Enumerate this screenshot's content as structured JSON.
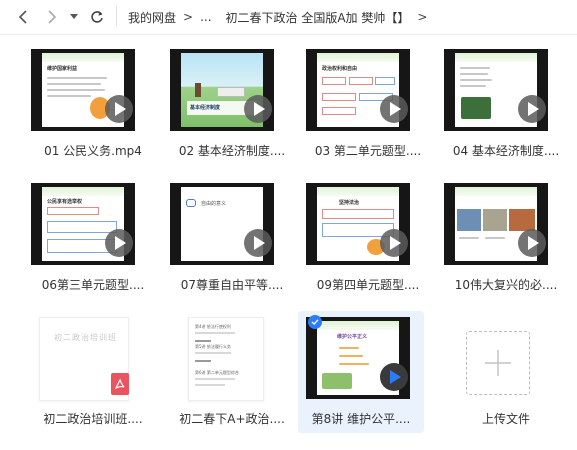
{
  "nav": {
    "back_glyph": "<",
    "forward_glyph": ">",
    "dropdown_glyph": "▾",
    "refresh_glyph": "↻"
  },
  "breadcrumb": {
    "root": "我的网盘",
    "sep": ">",
    "ellipsis": "...",
    "current": "初二春下政治 全国版A加 樊帅【】",
    "trailing": ">"
  },
  "files": [
    {
      "label": "01 公民义务.mp4",
      "kind": "video",
      "slide_title": "维护国家利益"
    },
    {
      "label": "02 基本经济制度....",
      "kind": "video",
      "slide_title": "基本经济制度"
    },
    {
      "label": "03 第二单元题型....",
      "kind": "video",
      "slide_title": "政治权利和自由"
    },
    {
      "label": "04 基本经济制度....",
      "kind": "video",
      "slide_title": ""
    },
    {
      "label": "06第三单元题型....",
      "kind": "video",
      "slide_title": "公民享有选举权"
    },
    {
      "label": "07尊重自由平等....",
      "kind": "video",
      "slide_title": "自由的意义"
    },
    {
      "label": "09第四单元题型....",
      "kind": "video",
      "slide_title": "坚持法治"
    },
    {
      "label": "10伟大复兴的必....",
      "kind": "video",
      "slide_title": ""
    },
    {
      "label": "初二政治培训班....",
      "kind": "pdf",
      "slide_title": "初二政治培训班"
    },
    {
      "label": "初二春下A+政治....",
      "kind": "doc",
      "slide_title": ""
    },
    {
      "label": "第8讲 维护公平....",
      "kind": "video",
      "slide_title": "维护公平正义",
      "selected": true
    },
    {
      "label": "上传文件",
      "kind": "upload",
      "slide_title": ""
    }
  ],
  "doc_preview": {
    "lines": [
      "第4讲 依法行使权利",
      "第5讲 依法履行义务",
      "第6讲 第二单元题型综合"
    ]
  },
  "colors": {
    "accent": "#2b7cf6",
    "selected_bg": "#eaf3fd",
    "pdf_red": "#e9545f"
  },
  "icons": {
    "video_play": "play-icon",
    "pdf": "pdf-icon",
    "upload": "plus-icon",
    "selected": "check-icon"
  }
}
